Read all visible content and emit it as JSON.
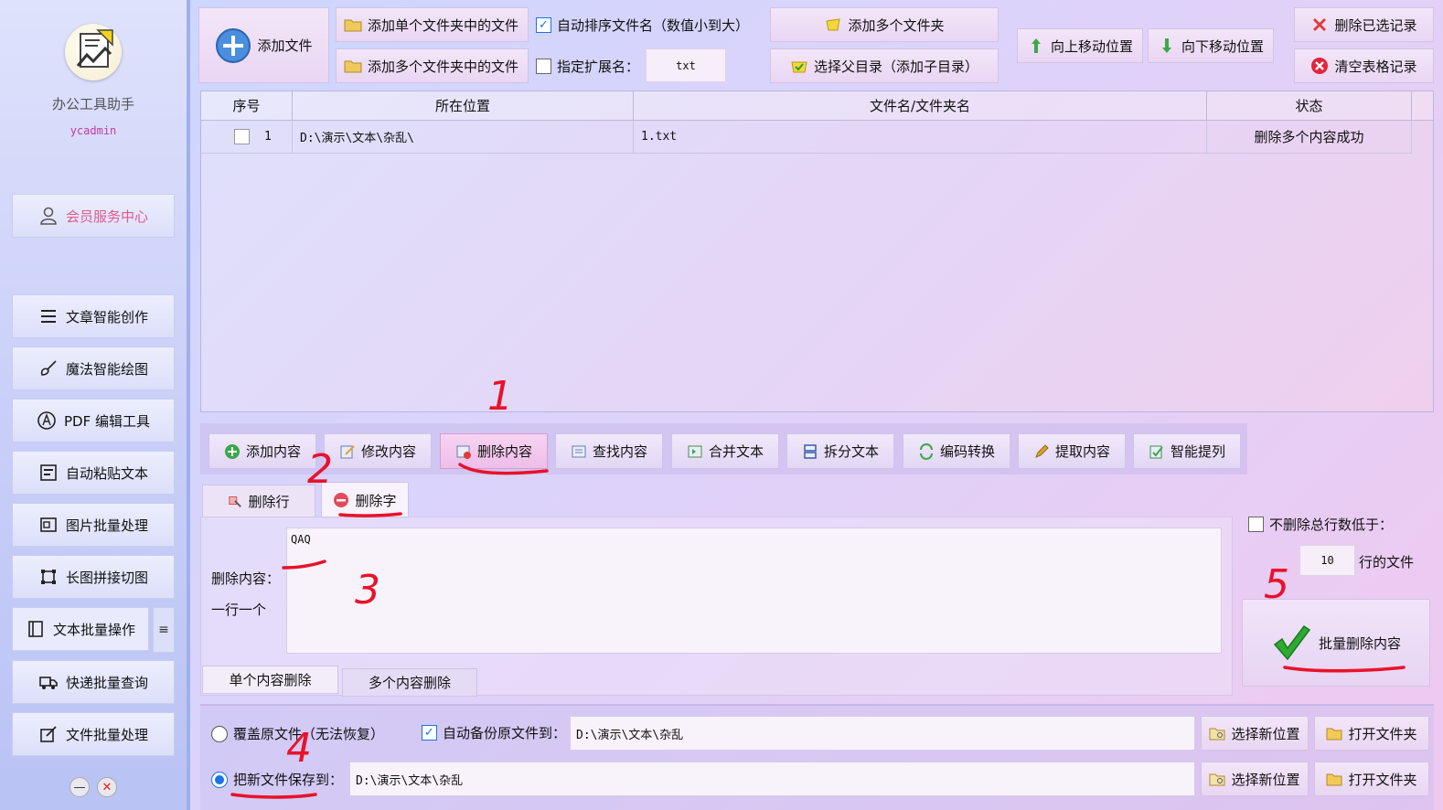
{
  "colors": {
    "accent": "#1a73e8",
    "annotation": "#e8122a",
    "member": "#e05a8d",
    "user": "#c23da0"
  },
  "sidebar": {
    "app_name": "办公工具助手",
    "user": "ycadmin",
    "member_center": "会员服务中心",
    "items": [
      {
        "label": "文章智能创作",
        "icon": "list-icon"
      },
      {
        "label": "魔法智能绘图",
        "icon": "brush-icon"
      },
      {
        "label": "PDF 编辑工具",
        "icon": "pdf-icon"
      },
      {
        "label": "自动粘贴文本",
        "icon": "paste-icon"
      },
      {
        "label": "图片批量处理",
        "icon": "image-icon"
      },
      {
        "label": "长图拼接切图",
        "icon": "crop-icon"
      },
      {
        "label": "文本批量操作",
        "icon": "book-icon"
      },
      {
        "label": "快递批量查询",
        "icon": "truck-icon"
      },
      {
        "label": "文件批量处理",
        "icon": "file-edit-icon"
      }
    ],
    "menu_toggle": "≡",
    "minimize": "—",
    "close": "✕"
  },
  "toolbar": {
    "add_file": "添加文件",
    "add_single_folder": "添加单个文件夹中的文件",
    "add_multi_folder_files": "添加多个文件夹中的文件",
    "auto_sort": "自动排序文件名（数值小到大）",
    "auto_sort_checked": true,
    "specify_ext": "指定扩展名：",
    "specify_ext_checked": false,
    "ext_value": "txt",
    "add_multi_folders": "添加多个文件夹",
    "select_parent": "选择父目录（添加子目录）",
    "move_up": "向上移动位置",
    "move_down": "向下移动位置",
    "delete_selected": "删除已选记录",
    "clear_table": "清空表格记录"
  },
  "table": {
    "headers": [
      "序号",
      "所在位置",
      "文件名/文件夹名",
      "状态"
    ],
    "rows": [
      {
        "index": "1",
        "location": "D:\\演示\\文本\\杂乱\\",
        "filename": "1.txt",
        "status": "删除多个内容成功"
      }
    ]
  },
  "functions": {
    "tabs": [
      "添加内容",
      "修改内容",
      "删除内容",
      "查找内容",
      "合并文本",
      "拆分文本",
      "编码转换",
      "提取内容",
      "智能提列"
    ],
    "active": "删除内容"
  },
  "sub_tabs": {
    "delete_line": "删除行",
    "delete_char": "删除字",
    "active": "删除字"
  },
  "delete_panel": {
    "content_label": "删除内容：",
    "one_per_line": "一行一个",
    "content_value": "QAQ",
    "single_mode": "单个内容删除",
    "multi_mode": "多个内容删除",
    "min_lines_label": "不删除总行数低于：",
    "min_lines_checked": false,
    "min_lines_value": "10",
    "min_lines_suffix": "行的文件",
    "batch_delete": "批量删除内容"
  },
  "save": {
    "overwrite": "覆盖原文件（无法恢复）",
    "overwrite_selected": false,
    "auto_backup": "自动备份原文件到：",
    "auto_backup_checked": true,
    "backup_path": "D:\\演示\\文本\\杂乱",
    "save_new": "把新文件保存到：",
    "save_new_selected": true,
    "save_path": "D:\\演示\\文本\\杂乱",
    "choose_location": "选择新位置",
    "open_folder": "打开文件夹"
  },
  "annotations": [
    "1",
    "2",
    "3",
    "4",
    "5"
  ]
}
